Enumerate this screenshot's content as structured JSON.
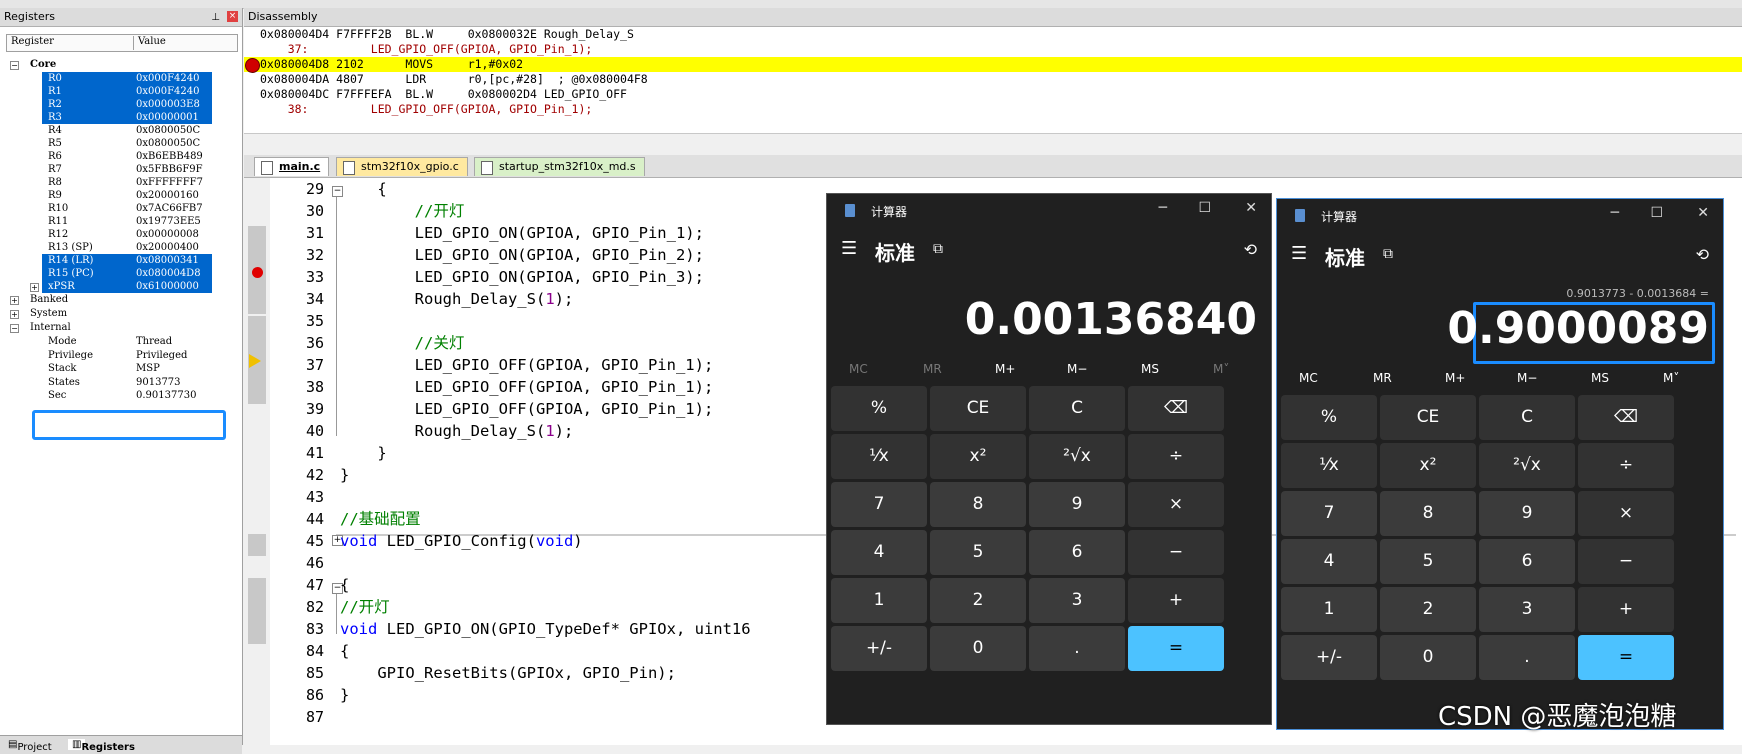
{
  "registers": {
    "title": "Registers",
    "col_register": "Register",
    "col_value": "Value",
    "core_label": "Core",
    "rows": [
      {
        "name": "R0",
        "value": "0x000F4240",
        "selected": true
      },
      {
        "name": "R1",
        "value": "0x000F4240",
        "selected": true
      },
      {
        "name": "R2",
        "value": "0x000003E8",
        "selected": true
      },
      {
        "name": "R3",
        "value": "0x00000001",
        "selected": true
      },
      {
        "name": "R4",
        "value": "0x0800050C",
        "selected": false
      },
      {
        "name": "R5",
        "value": "0x0800050C",
        "selected": false
      },
      {
        "name": "R6",
        "value": "0xB6EBB489",
        "selected": false
      },
      {
        "name": "R7",
        "value": "0x5FBB6F9F",
        "selected": false
      },
      {
        "name": "R8",
        "value": "0xFFFFFFF7",
        "selected": false
      },
      {
        "name": "R9",
        "value": "0x20000160",
        "selected": false
      },
      {
        "name": "R10",
        "value": "0x7AC66FB7",
        "selected": false
      },
      {
        "name": "R11",
        "value": "0x19773EE5",
        "selected": false
      },
      {
        "name": "R12",
        "value": "0x00000008",
        "selected": false
      },
      {
        "name": "R13 (SP)",
        "value": "0x20000400",
        "selected": false
      },
      {
        "name": "R14 (LR)",
        "value": "0x08000341",
        "selected": true
      },
      {
        "name": "R15 (PC)",
        "value": "0x080004D8",
        "selected": true
      },
      {
        "name": "xPSR",
        "value": "0x61000000",
        "selected": true
      }
    ],
    "banked": "Banked",
    "system": "System",
    "internal": "Internal",
    "internal_rows": [
      {
        "name": "Mode",
        "value": "Thread"
      },
      {
        "name": "Privilege",
        "value": "Privileged"
      },
      {
        "name": "Stack",
        "value": "MSP"
      },
      {
        "name": "States",
        "value": "9013773"
      },
      {
        "name": "Sec",
        "value": "0.90137730"
      }
    ],
    "tab_project": "Project",
    "tab_registers": "Registers"
  },
  "disassembly": {
    "title": "Disassembly",
    "lines": [
      "0x080004D4 F7FFFF2B  BL.W     0x0800032E Rough_Delay_S",
      "    37:         LED_GPIO_OFF(GPIOA, GPIO_Pin_1);",
      "0x080004D8 2102      MOVS     r1,#0x02",
      "0x080004DA 4807      LDR      r0,[pc,#28]  ; @0x080004F8",
      "0x080004DC F7FFFEFA  BL.W     0x080002D4 LED_GPIO_OFF",
      "    38:         LED_GPIO_OFF(GPIOA, GPIO_Pin_1);"
    ]
  },
  "editor_tabs": [
    "main.c",
    "stm32f10x_gpio.c",
    "startup_stm32f10x_md.s"
  ],
  "code_lines": [
    {
      "n": "29",
      "t": "    {"
    },
    {
      "n": "30",
      "t": "        //开灯"
    },
    {
      "n": "31",
      "t": "        LED_GPIO_ON(GPIOA, GPIO_Pin_1);"
    },
    {
      "n": "32",
      "t": "        LED_GPIO_ON(GPIOA, GPIO_Pin_2);"
    },
    {
      "n": "33",
      "t": "        LED_GPIO_ON(GPIOA, GPIO_Pin_3);"
    },
    {
      "n": "34",
      "t": "        Rough_Delay_S(1);"
    },
    {
      "n": "35",
      "t": ""
    },
    {
      "n": "36",
      "t": "        //关灯"
    },
    {
      "n": "37",
      "t": "        LED_GPIO_OFF(GPIOA, GPIO_Pin_1);"
    },
    {
      "n": "38",
      "t": "        LED_GPIO_OFF(GPIOA, GPIO_Pin_1);"
    },
    {
      "n": "39",
      "t": "        LED_GPIO_OFF(GPIOA, GPIO_Pin_1);"
    },
    {
      "n": "40",
      "t": "        Rough_Delay_S(1);"
    },
    {
      "n": "41",
      "t": "    }"
    },
    {
      "n": "42",
      "t": "}"
    },
    {
      "n": "43",
      "t": ""
    },
    {
      "n": "44",
      "t": "//基础配置"
    },
    {
      "n": "45",
      "t": "void LED_GPIO_Config(void)"
    },
    {
      "n": "46",
      "t": ""
    },
    {
      "n": "47",
      "t": "{"
    },
    {
      "n": "82",
      "t": "//开灯"
    },
    {
      "n": "83",
      "t": "void LED_GPIO_ON(GPIO_TypeDef* GPIOx, uint16"
    },
    {
      "n": "84",
      "t": "{"
    },
    {
      "n": "85",
      "t": "    GPIO_ResetBits(GPIOx, GPIO_Pin);"
    },
    {
      "n": "86",
      "t": "}"
    },
    {
      "n": "87",
      "t": ""
    }
  ],
  "calc1": {
    "title": "计算器",
    "mode": "标准",
    "display": "0.00136840",
    "expression": ""
  },
  "calc2": {
    "title": "计算器",
    "mode": "标准",
    "display": "0.9000089",
    "expression": "0.9013773 - 0.0013684 ="
  },
  "memory_buttons": [
    "MC",
    "MR",
    "M+",
    "M−",
    "MS",
    "M˅"
  ],
  "keypad": [
    [
      "%",
      "CE",
      "C",
      "⌫"
    ],
    [
      "¹⁄x",
      "x²",
      "²√x",
      "÷"
    ],
    [
      "7",
      "8",
      "9",
      "×"
    ],
    [
      "4",
      "5",
      "6",
      "−"
    ],
    [
      "1",
      "2",
      "3",
      "+"
    ],
    [
      "+/-",
      "0",
      ".",
      "="
    ]
  ],
  "watermark": "CSDN @恶魔泡泡糖"
}
